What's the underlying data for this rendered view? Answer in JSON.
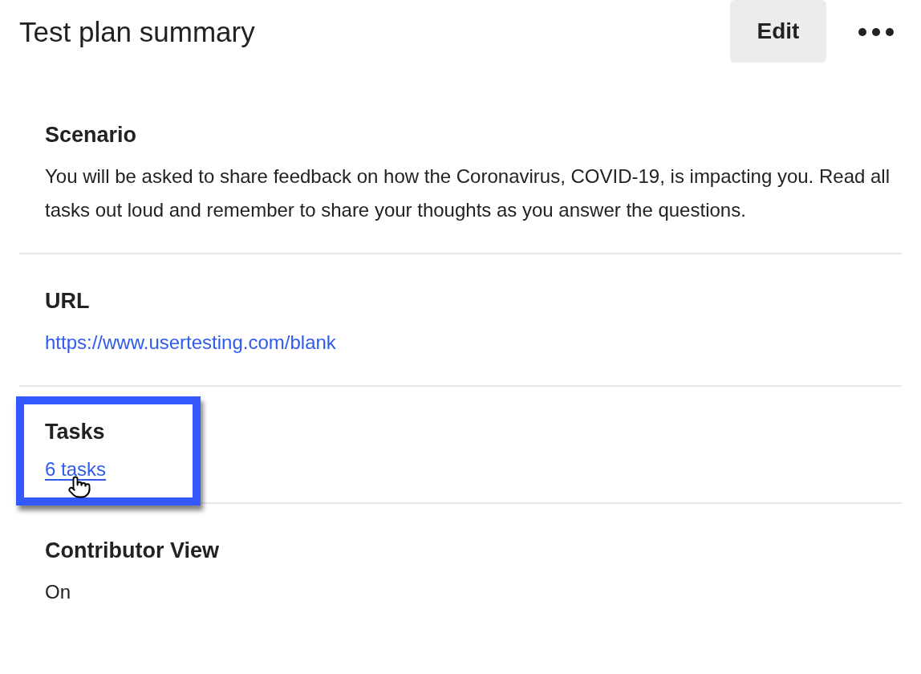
{
  "header": {
    "title": "Test plan summary",
    "edit_button": "Edit"
  },
  "sections": [
    {
      "heading": "Scenario",
      "kind": "text",
      "value": "You will be asked to share feedback on how the Coronavirus, COVID-19, is impacting you. Read all tasks out loud and remember to share your thoughts as you answer the questions.",
      "highlighted": false
    },
    {
      "heading": "URL",
      "kind": "link",
      "value": "https://www.usertesting.com/blank",
      "highlighted": false
    },
    {
      "heading": "Tasks",
      "kind": "link",
      "value": "6 tasks",
      "highlighted": true
    },
    {
      "heading": "Contributor View",
      "kind": "text",
      "value": "On",
      "highlighted": false
    }
  ]
}
